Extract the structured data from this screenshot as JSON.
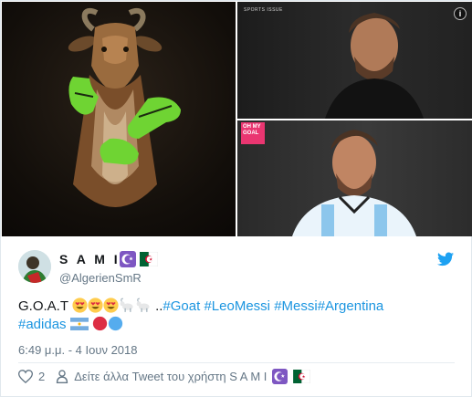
{
  "media": {
    "top_right_caption": "SPORTS ISSUE",
    "info_icon": "info-icon",
    "logo_text": "OH MY GOAL"
  },
  "author": {
    "display_name": "S A M I",
    "username": "@AlgerienSmR",
    "badges": [
      "crescent-badge-icon",
      "algeria-flag-icon"
    ]
  },
  "tweet": {
    "prefix": "G.O.A.T",
    "dots": "..",
    "hashtags": [
      "#Goat",
      "#LeoMessi",
      "#Messi#Argentina",
      "#adidas"
    ],
    "emojis": [
      "heart-eyes-emoji",
      "heart-eyes-emoji",
      "heart-eyes-emoji",
      "goat-emoji",
      "goat-emoji",
      "argentina-flag-emoji",
      "red-circle-emoji",
      "blue-circle-emoji"
    ]
  },
  "timestamp": "6:49 μ.μ. - 4 Ιουν 2018",
  "footer": {
    "like_count": "2",
    "more_tweets_label": "Δείτε άλλα Tweet του χρήστη S A M I"
  },
  "colors": {
    "link": "#1b95e0",
    "muted": "#657786",
    "twitter_blue": "#1da1f2",
    "heart": "#657786"
  }
}
